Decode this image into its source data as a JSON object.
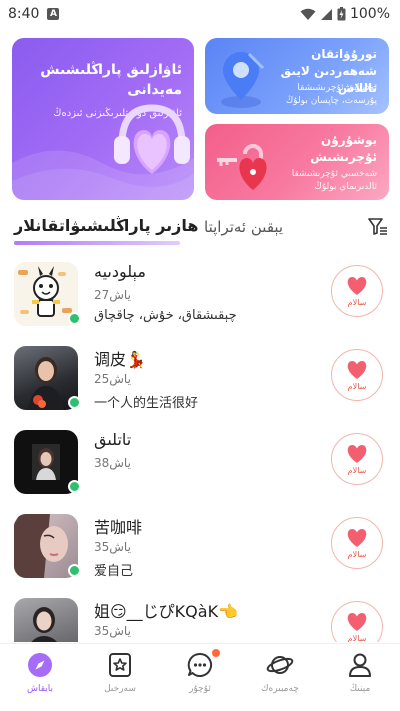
{
  "status_bar": {
    "time": "8:40",
    "notification_letter": "A",
    "battery": "100%"
  },
  "banners": {
    "voice_room": {
      "title": "ئاۋازلىق پاراڭلىشىش مەيدانى",
      "subtitle": "ئاۋازلىق دوستلىرىڭىزنى ئىزدەڭ"
    },
    "smart_match": {
      "title": "تورۇۋاتقان شەھەردىن لايىق تاللاش",
      "subtitle": "ئەقىللىق ئۇچرىشىشقا پۇرسەت، چاپسان بولۇڭ"
    },
    "private_date": {
      "title": "يوشۇرۇن ئۇچرىشىش",
      "subtitle": "شەخسىي ئۇچرىشىشقا ئالدىرىماي بولۇڭ"
    }
  },
  "tabs": {
    "online_now": "ھازىر پاراڭلىشىۋاتقانلار",
    "nearby": "يېقىن ئەتراپتا"
  },
  "users": [
    {
      "name": "مېلودىيە",
      "age": "27ياش",
      "bio": "چېقىشقاق، خۇش، چاقچاق"
    },
    {
      "name": "调皮💃",
      "age": "25ياش",
      "bio": "一个人的生活很好"
    },
    {
      "name": "تاتلىق",
      "age": "38ياش",
      "bio": ""
    },
    {
      "name": "苦咖啡",
      "age": "35ياش",
      "bio": "爱自己"
    },
    {
      "name": "姐😏__じぴKQàK👈",
      "age": "35ياش",
      "bio": ""
    }
  ],
  "hello_label": "سالام",
  "nav": {
    "discover": "بايقاش",
    "square": "سەرخىل",
    "messages": "ئۇچۇر",
    "planet": "چەمبىرەك",
    "me": "مېنىڭ"
  },
  "colors": {
    "accent": "#9b5cf6",
    "online": "#2fbf71",
    "heart": "#f25f6f"
  }
}
